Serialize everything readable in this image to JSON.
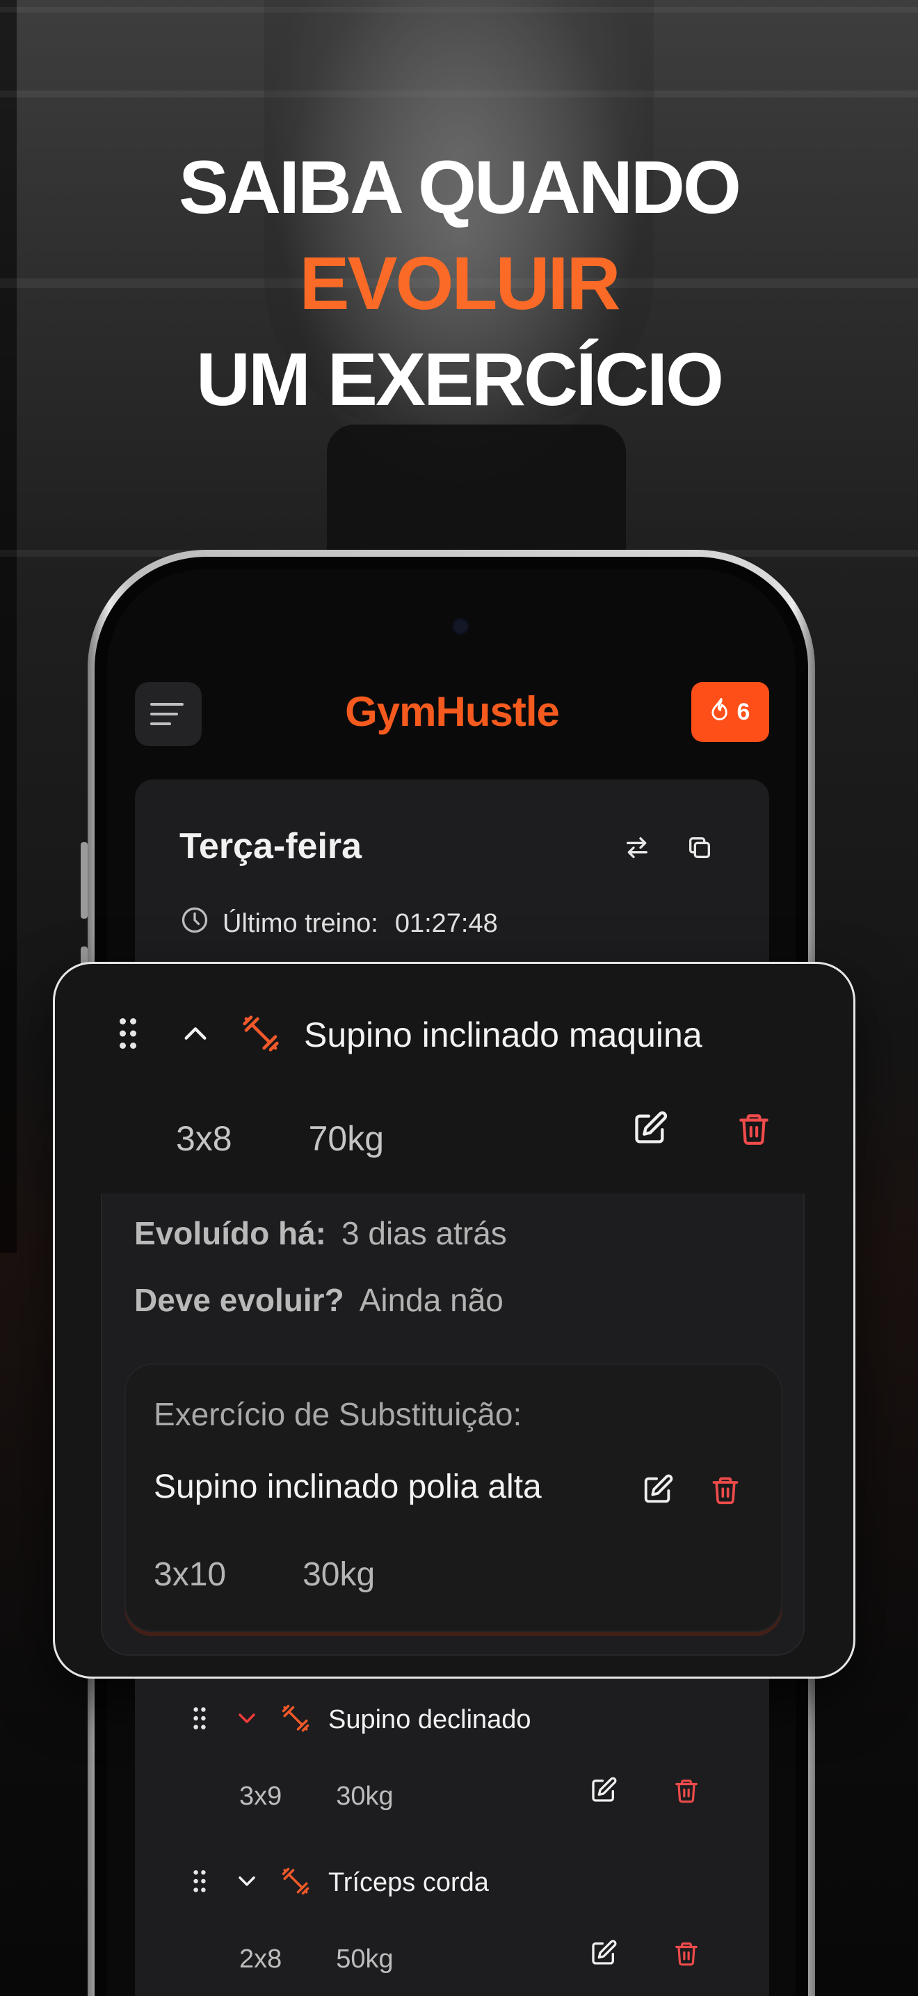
{
  "headline": {
    "line1": "SAIBA QUANDO",
    "line2": "EVOLUIR",
    "line3": "UM EXERCÍCIO"
  },
  "app": {
    "brand": "GymHustle",
    "streak_count": "6",
    "accent_color": "#f55a1e"
  },
  "day_card": {
    "title": "Terça-feira",
    "last_workout_label": "Último treino:",
    "last_workout_time": "01:27:48"
  },
  "expanded_exercise": {
    "name": "Supino inclinado maquina",
    "sets_reps": "3x8",
    "weight": "70kg",
    "evolved_label": "Evoluído há:",
    "evolved_value": "3 dias atrás",
    "should_evolve_label": "Deve evoluir?",
    "should_evolve_value": "Ainda não",
    "substitution": {
      "label": "Exercício de Substituição:",
      "name": "Supino inclinado polia alta",
      "sets_reps": "3x10",
      "weight": "30kg"
    }
  },
  "exercise_list": [
    {
      "name": "Supino declinado",
      "sets_reps": "3x9",
      "weight": "30kg",
      "chevron": "down-red"
    },
    {
      "name": "Tríceps corda",
      "sets_reps": "2x8",
      "weight": "50kg",
      "chevron": "down-white"
    }
  ]
}
